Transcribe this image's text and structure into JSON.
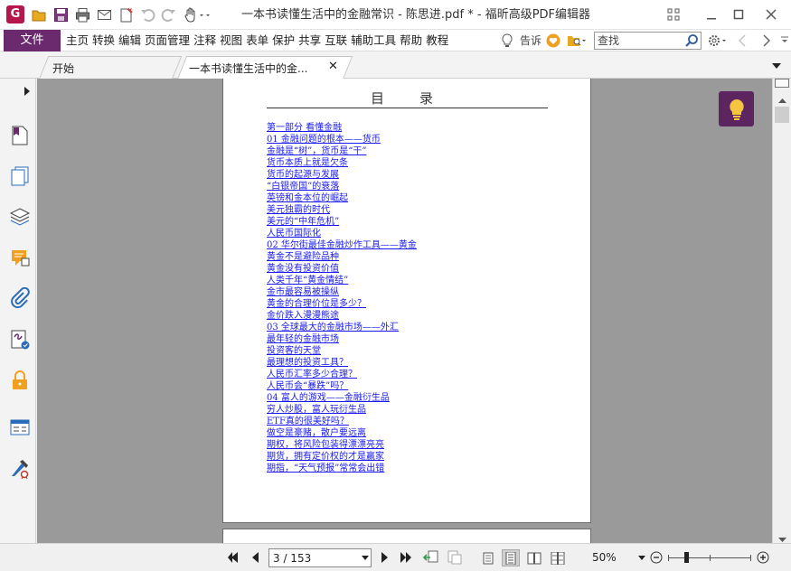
{
  "app": {
    "title": "一本书读懂生活中的金融常识 - 陈思进.pdf * - 福昕高级PDF编辑器",
    "logo_letter": "G"
  },
  "menu": {
    "file_label": "文件",
    "items": [
      "主页",
      "转换",
      "编辑",
      "页面管理",
      "注释",
      "视图",
      "表单",
      "保护",
      "共享",
      "互联",
      "辅助工具",
      "帮助",
      "教程"
    ],
    "tell_me_label": "告诉",
    "search_placeholder": "查找"
  },
  "tabs": [
    {
      "label": "开始",
      "active": false
    },
    {
      "label": "一本书读懂生活中的金...",
      "active": true,
      "close": "✕"
    }
  ],
  "document": {
    "toc_title": "目　录",
    "toc_items": [
      "第一部分 看懂金融",
      "01 金融问题的根本——货币",
      "金融是“树”，货币是“干”",
      "货币本质上就是欠条",
      "货币的起源与发展",
      "“白银帝国”的衰落",
      "英镑和金本位的崛起",
      "美元独霸的时代",
      "美元的“中年危机”",
      "人民币国际化",
      "02 华尔街最佳金融炒作工具——黄金",
      "黄金不是避险品种",
      "黄金没有投资价值",
      "人类千年“黄金情结”",
      "金市最容易被操纵",
      "黄金的合理价位是多少？",
      "金价跌入漫漫熊途",
      "03 全球最大的金融市场——外汇",
      "最年轻的金融市场",
      "投资客的天堂",
      "最理想的投资工具？",
      "人民币汇率多少合理？",
      "人民币会“暴跌”吗？",
      "04 富人的游戏——金融衍生品",
      "穷人炒股，富人玩衍生品",
      "ETF真的很美好吗？",
      "做空是豪赌，散户要远离",
      "期权，将风险包装得漂漂亮亮",
      "期货，拥有定价权的才是赢家",
      "期指，“天气预报”常常会出错"
    ]
  },
  "statusbar": {
    "page_value": "3 / 153",
    "zoom_value": "50%",
    "zoom_level": 0.22
  },
  "colors": {
    "accent": "#6b2a6e",
    "link": "#1a1aee",
    "doc_background": "#9a9a9a"
  },
  "icons": {
    "quick_access": [
      "open-folder-icon",
      "save-icon",
      "print-icon",
      "email-icon",
      "new-icon",
      "undo-icon",
      "redo-icon",
      "hand-tool-icon"
    ],
    "sidebar": [
      "pages-icon",
      "layers-icon",
      "comments-icon",
      "attachments-icon",
      "signature-icon",
      "security-icon",
      "fields-icon",
      "certificate-icon"
    ]
  }
}
